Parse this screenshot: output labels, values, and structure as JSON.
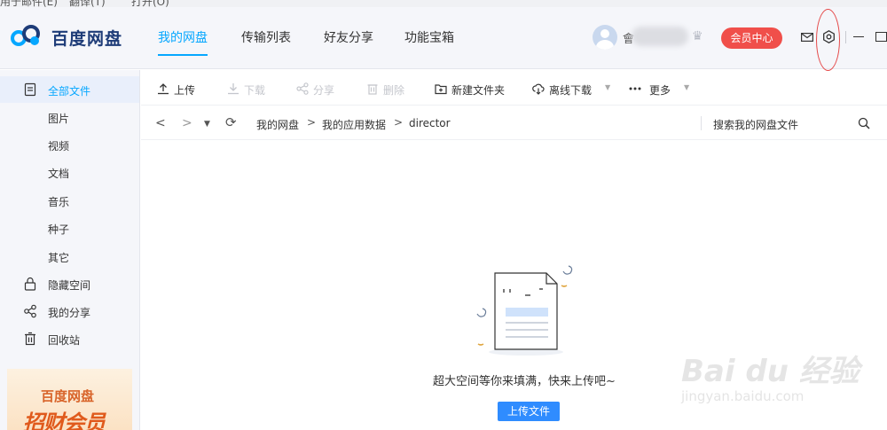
{
  "menu_strip": [
    "用于邮件(E)",
    "翻译(T)",
    "打开(O)"
  ],
  "header": {
    "logo_text": "百度网盘",
    "tabs": [
      "我的网盘",
      "传输列表",
      "好友分享",
      "功能宝箱"
    ],
    "username_initial": "會",
    "vip_button": "会员中心",
    "colors": {
      "accent": "#06a7ff",
      "vip": "#f04f4a"
    }
  },
  "sidebar": {
    "items": [
      {
        "label": "全部文件",
        "icon": "file-list-icon"
      },
      {
        "label": "图片"
      },
      {
        "label": "视频"
      },
      {
        "label": "文档"
      },
      {
        "label": "音乐"
      },
      {
        "label": "种子"
      },
      {
        "label": "其它"
      },
      {
        "label": "隐藏空间",
        "icon": "lock-icon"
      },
      {
        "label": "我的分享",
        "icon": "share-icon"
      },
      {
        "label": "回收站",
        "icon": "trash-icon"
      }
    ],
    "promo": {
      "title": "百度网盘",
      "slogan": "招财会员"
    }
  },
  "toolbar": {
    "upload": "上传",
    "download": "下载",
    "share": "分享",
    "delete": "删除",
    "new_folder": "新建文件夹",
    "offline_download": "离线下载",
    "more": "更多"
  },
  "path": {
    "crumbs": [
      "我的网盘",
      "我的应用数据",
      "director"
    ],
    "separator": ">",
    "search_placeholder": "搜索我的网盘文件"
  },
  "empty_state": {
    "message": "超大空间等你来填满，快来上传吧~",
    "button": "上传文件"
  },
  "watermark": {
    "line1": "Bai du 经验",
    "line2": "jingyan.baidu.com"
  }
}
